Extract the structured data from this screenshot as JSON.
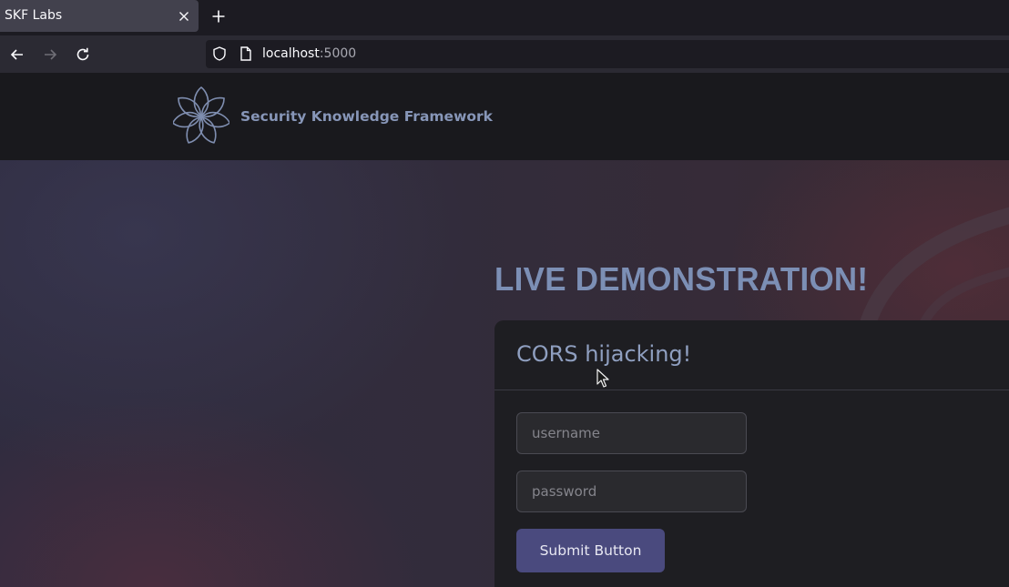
{
  "browser": {
    "tab": {
      "title": "SKF Labs"
    },
    "url": {
      "host": "localhost",
      "port": ":5000"
    }
  },
  "header": {
    "brand": "Security Knowledge Framework"
  },
  "hero": {
    "title": "LIVE DEMONSTRATION!"
  },
  "form": {
    "title": "CORS hijacking!",
    "username_placeholder": "username",
    "password_placeholder": "password",
    "submit_label": "Submit Button"
  },
  "colors": {
    "accent": "#4a4a7e",
    "brand": "#8796b8",
    "hero_title": "#7c8fb5"
  },
  "icons": [
    "close-icon",
    "plus-icon",
    "back-arrow-icon",
    "forward-arrow-icon",
    "reload-icon",
    "shield-icon",
    "page-icon",
    "skf-flower-logo",
    "mouse-cursor"
  ]
}
